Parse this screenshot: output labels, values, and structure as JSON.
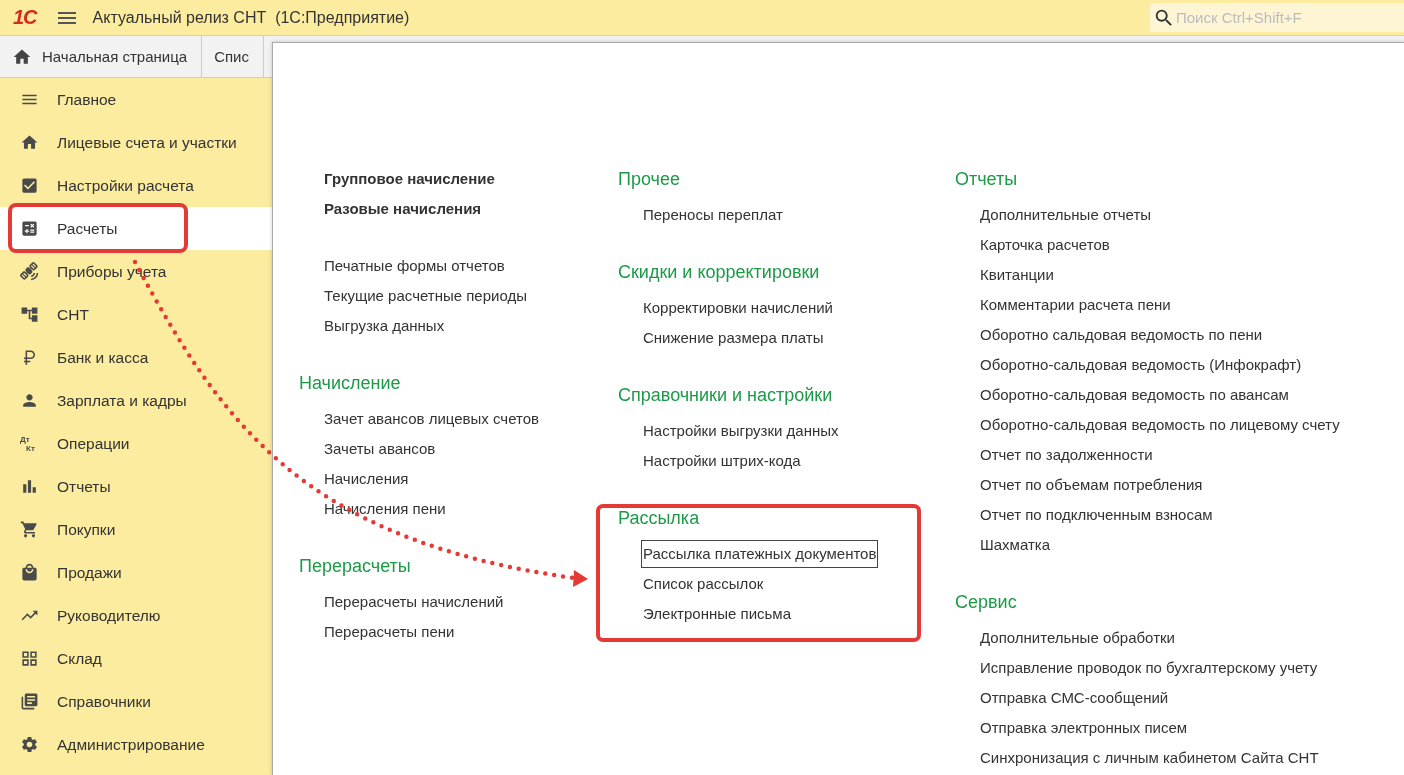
{
  "app_bar": {
    "logo": "1С",
    "title": "Актуальный релиз СНТ  (1С:Предприятие)",
    "search": {
      "placeholder": "Поиск Ctrl+Shift+F"
    }
  },
  "tabs": [
    {
      "label": "Начальная страница",
      "selected": false
    },
    {
      "label": "Спис",
      "selected": false
    }
  ],
  "sidebar": {
    "items": [
      {
        "label": "Главное",
        "selected": false
      },
      {
        "label": "Лицевые счета и участки",
        "selected": false
      },
      {
        "label": "Настройки расчета",
        "selected": false
      },
      {
        "label": "Расчеты",
        "selected": true
      },
      {
        "label": "Приборы учета",
        "selected": false
      },
      {
        "label": "СНТ",
        "selected": false
      },
      {
        "label": "Банк и касса",
        "selected": false
      },
      {
        "label": "Зарплата и кадры",
        "selected": false
      },
      {
        "label": "Операции",
        "icon_text": [
          "Дт",
          "Кт"
        ],
        "selected": false
      },
      {
        "label": "Отчеты",
        "selected": false
      },
      {
        "label": "Покупки",
        "selected": false
      },
      {
        "label": "Продажи",
        "selected": false
      },
      {
        "label": "Руководителю",
        "selected": false
      },
      {
        "label": "Склад",
        "selected": false
      },
      {
        "label": "Справочники",
        "selected": false
      },
      {
        "label": "Администрирование",
        "selected": false
      }
    ]
  },
  "panel": {
    "columns": [
      {
        "groups": [
          {
            "kind": "bold",
            "items": [
              {
                "label": "Групповое начисление"
              },
              {
                "label": "Разовые начисления"
              }
            ]
          },
          {
            "kind": "plain",
            "items": [
              {
                "label": "Печатные формы отчетов"
              },
              {
                "label": "Текущие расчетные периоды"
              },
              {
                "label": "Выгрузка данных"
              }
            ]
          },
          {
            "kind": "plain",
            "title": "Начисление",
            "items": [
              {
                "label": "Зачет авансов лицевых счетов"
              },
              {
                "label": "Зачеты авансов"
              },
              {
                "label": "Начисления"
              },
              {
                "label": "Начисления пени"
              }
            ]
          },
          {
            "kind": "plain",
            "title": "Перерасчеты",
            "items": [
              {
                "label": "Перерасчеты начислений"
              },
              {
                "label": "Перерасчеты пени"
              }
            ]
          }
        ]
      },
      {
        "groups": [
          {
            "kind": "plain",
            "title": "Прочее",
            "items": [
              {
                "label": "Переносы переплат"
              }
            ]
          },
          {
            "kind": "plain",
            "title": "Скидки и корректировки",
            "items": [
              {
                "label": "Корректировки начислений"
              },
              {
                "label": "Снижение размера платы"
              }
            ]
          },
          {
            "kind": "plain",
            "title": "Справочники и настройки",
            "items": [
              {
                "label": "Настройки выгрузки данных"
              },
              {
                "label": "Настройки штрих-кода"
              }
            ]
          },
          {
            "kind": "plain",
            "title": "Рассылка",
            "items": [
              {
                "label": "Рассылка платежных документов",
                "focused": true
              },
              {
                "label": "Список рассылок",
                "focused": false
              },
              {
                "label": "Электронные письма",
                "focused": false
              }
            ]
          }
        ]
      },
      {
        "groups": [
          {
            "kind": "plain",
            "title": "Отчеты",
            "items": [
              {
                "label": "Дополнительные отчеты"
              },
              {
                "label": "Карточка расчетов"
              },
              {
                "label": "Квитанции"
              },
              {
                "label": "Комментарии расчета пени"
              },
              {
                "label": "Оборотно сальдовая ведомость по пени"
              },
              {
                "label": "Оборотно-сальдовая ведомость (Инфокрафт)"
              },
              {
                "label": "Оборотно-сальдовая ведомость по авансам"
              },
              {
                "label": "Оборотно-сальдовая ведомость по лицевому счету"
              },
              {
                "label": "Отчет по задолженности"
              },
              {
                "label": "Отчет по объемам потребления"
              },
              {
                "label": "Отчет по подключенным взносам"
              },
              {
                "label": "Шахматка"
              }
            ]
          },
          {
            "kind": "plain",
            "title": "Сервис",
            "items": [
              {
                "label": "Дополнительные обработки"
              },
              {
                "label": "Исправление проводок по бухгалтерскому учету"
              },
              {
                "label": "Отправка СМС-сообщений"
              },
              {
                "label": "Отправка электронных писем"
              },
              {
                "label": "Синхронизация с личным кабинетом Сайта СНТ"
              }
            ]
          }
        ]
      }
    ]
  }
}
